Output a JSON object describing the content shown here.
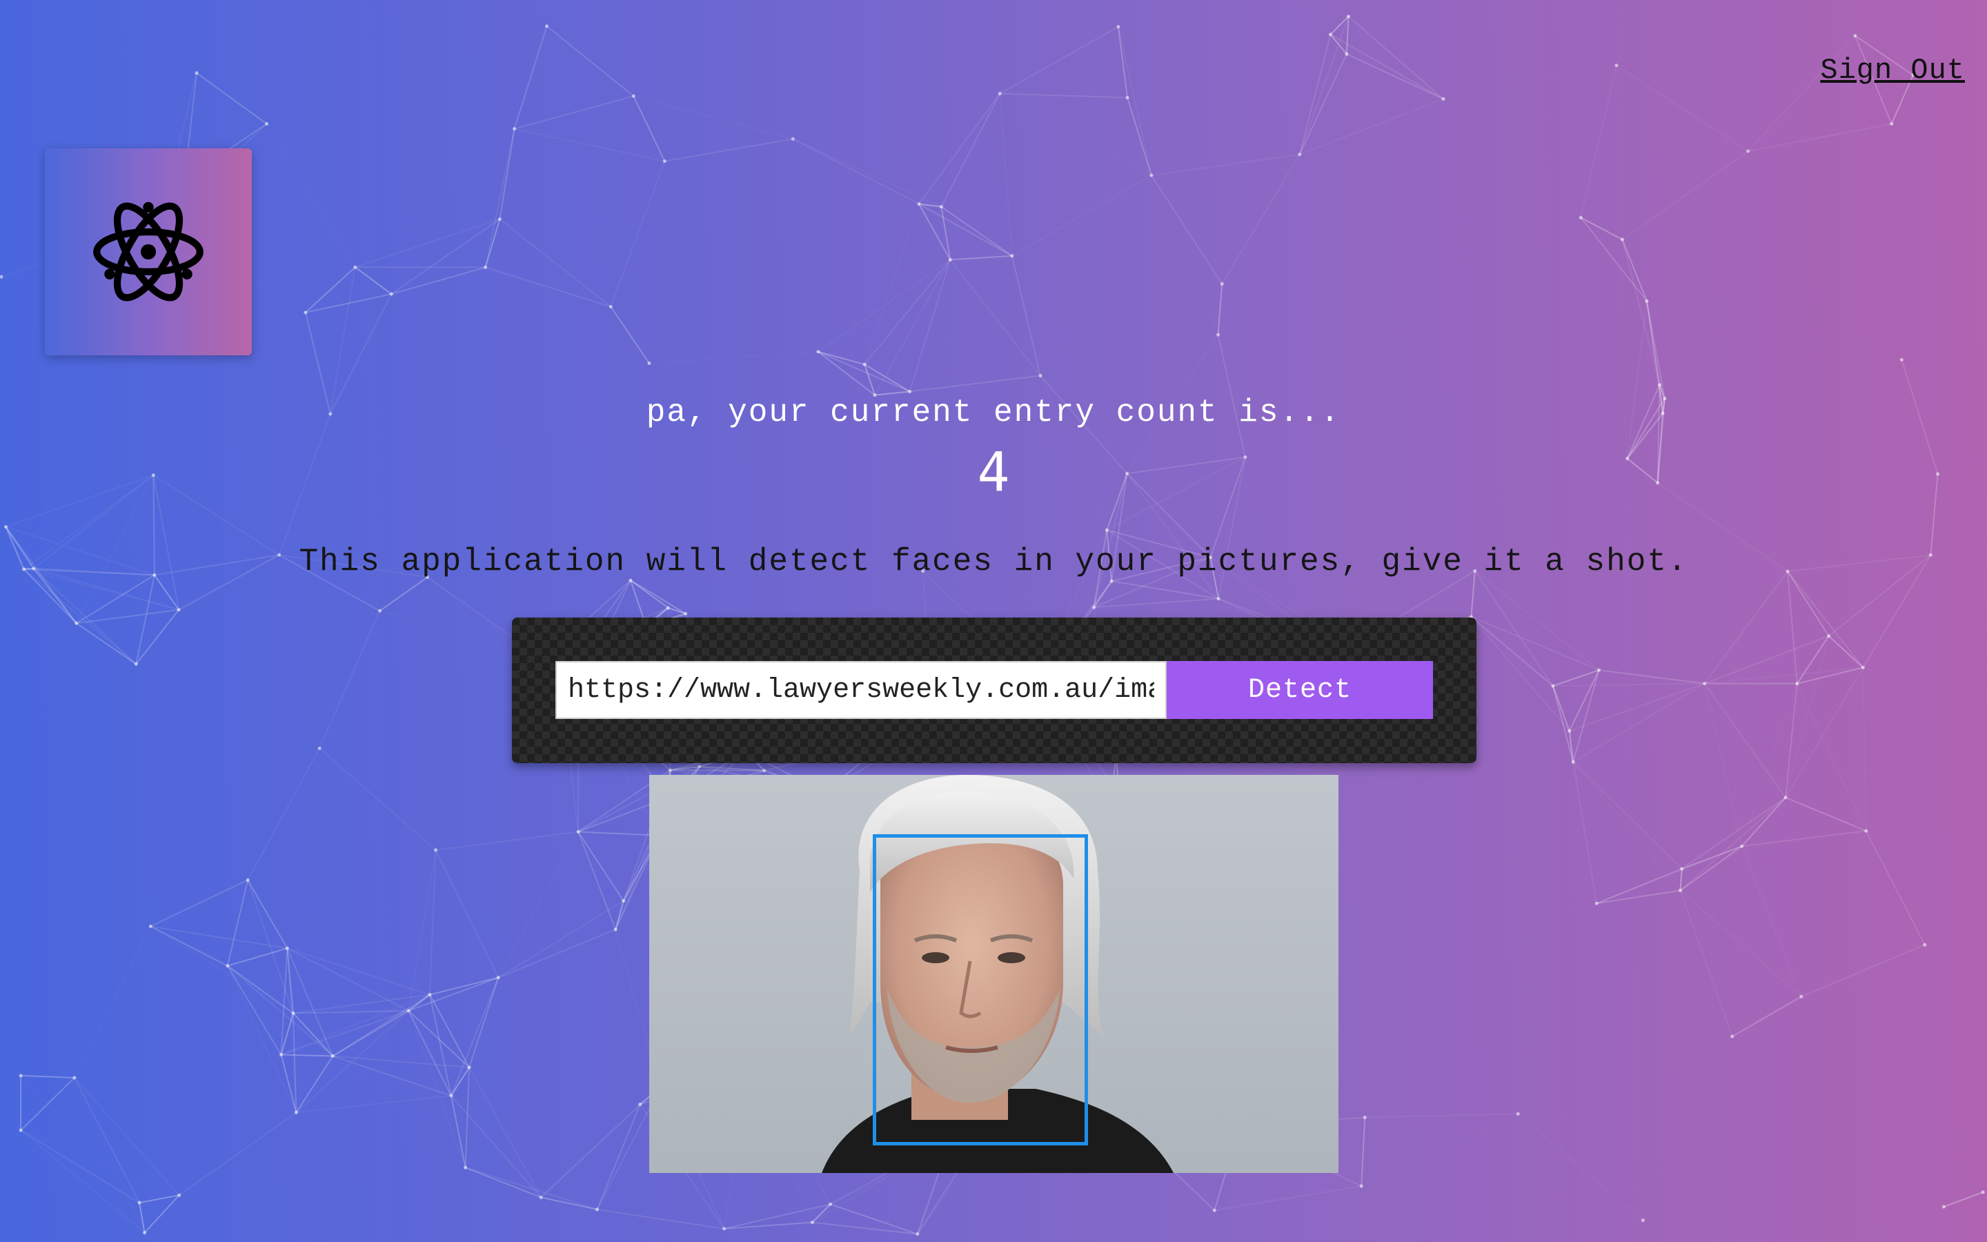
{
  "header": {
    "sign_out_label": "Sign Out"
  },
  "logo": {
    "icon": "atom-icon"
  },
  "rank": {
    "greeting": "pa, your current entry count is...",
    "count": "4"
  },
  "description": "This application will detect faces in your pictures, give it a shot.",
  "form": {
    "url_value": "https://www.lawyersweekly.com.au/images/",
    "button_label": "Detect"
  },
  "result": {
    "face_count": 1,
    "box_color": "#1f8fe8"
  },
  "colors": {
    "gradient_start": "#4a67de",
    "gradient_end": "#b064b2",
    "button": "#9f5aef"
  }
}
